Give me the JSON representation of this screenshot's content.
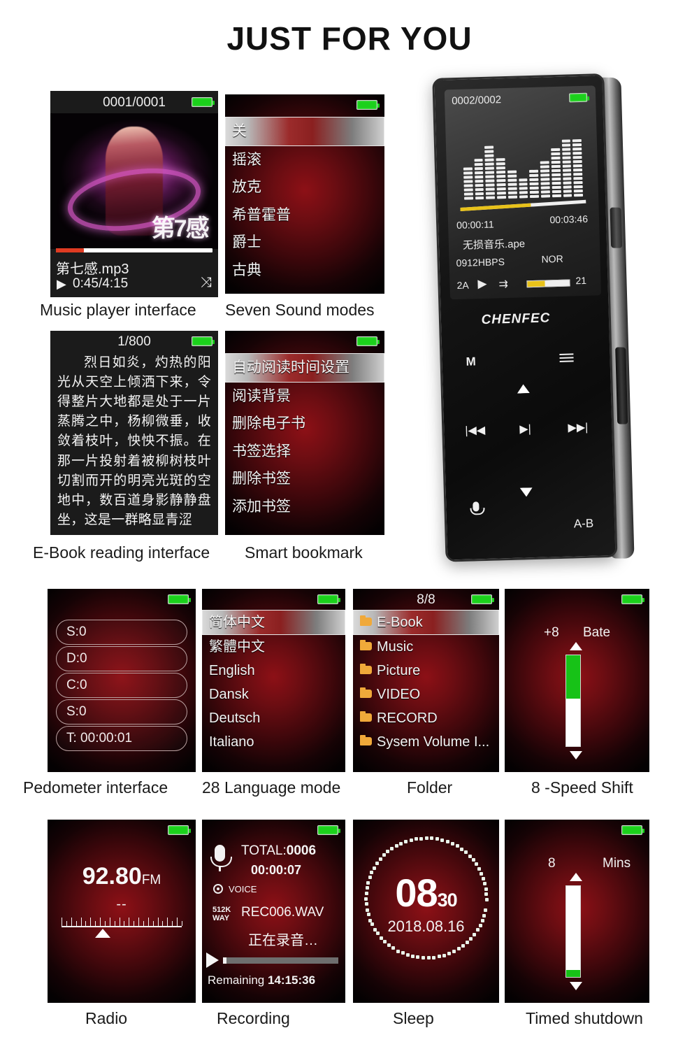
{
  "title": "JUST FOR YOU",
  "screens": {
    "music_player": {
      "caption": "Music player interface",
      "header_count": "0001/0001",
      "album_char": "第7感",
      "track": "第七感.mp3",
      "time": "0:45/4:15",
      "play_glyph": "▶",
      "shuffle_glyph": "⤨",
      "progress_percent": 18
    },
    "sound_modes": {
      "caption": "Seven Sound modes",
      "items": [
        "关",
        "摇滚",
        "放克",
        "希普霍普",
        "爵士",
        "古典"
      ],
      "selected_index": 0
    },
    "ebook": {
      "caption": "E-Book reading interface",
      "header_count": "1/800",
      "body": "烈日如炎，灼热的阳光从天空上倾洒下来，令得整片大地都是处于一片蒸腾之中，杨柳微垂，收敛着枝叶，怏怏不振。在那一片投射着被柳树枝叶切割而开的明亮光斑的空地中，数百道身影静静盘坐，这是一群略显青涩"
    },
    "bookmark": {
      "caption": "Smart bookmark",
      "items": [
        "自动阅读时间设置",
        "阅读背景",
        "删除电子书",
        "书签选择",
        "删除书签",
        "添加书签"
      ],
      "selected_index": 0
    },
    "pedometer": {
      "caption": "Pedometer interface",
      "rows": [
        "S:0",
        "D:0",
        "C:0",
        "S:0",
        "T:   00:00:01"
      ]
    },
    "language": {
      "caption": "28 Language mode",
      "items": [
        "简体中文",
        "繁體中文",
        "English",
        "Dansk",
        "Deutsch",
        "Italiano"
      ],
      "selected_index": 0
    },
    "folder": {
      "caption": "Folder",
      "header_count": "8/8",
      "items": [
        "E-Book",
        "Music",
        "Picture",
        "VIDEO",
        "RECORD",
        "Sysem Volume I..."
      ],
      "selected_index": 0
    },
    "speed_shift": {
      "caption": "8 -Speed Shift",
      "value": "+8",
      "unit": "Bate",
      "fill_percent": 48
    },
    "radio": {
      "caption": "Radio",
      "frequency": "92.80",
      "band": "FM",
      "station": "--"
    },
    "recording": {
      "caption": "Recording",
      "total_label": "TOTAL:",
      "total_value": "0006",
      "elapsed": "00:00:07",
      "mode": "VOICE",
      "bitrate_line1": "512K",
      "bitrate_line2": "WAY",
      "file": "REC006.WAV",
      "status": "正在录音…",
      "remaining_label": "Remaining",
      "remaining_value": "14:15:36",
      "progress_percent": 3
    },
    "sleep": {
      "caption": "Sleep",
      "hour": "08",
      "minute": "30",
      "date": "2018.08.16"
    },
    "timed_shutdown": {
      "caption": "Timed shutdown",
      "value": "8",
      "unit": "Mins",
      "fill_percent": 8
    }
  },
  "device": {
    "brand": "CHENFEC",
    "screen": {
      "header_count": "0002/0002",
      "elapsed": "00:00:11",
      "duration": "00:03:46",
      "track": "无损音乐.ape",
      "bitrate": "0912HBPS",
      "eq_mode": "NOR",
      "repeat_mode": "2A",
      "play_glyph": "▶",
      "loop_glyph": "⇉",
      "volume": "21"
    },
    "touch_keys": {
      "mode": "M",
      "ab_repeat": "A-B"
    }
  }
}
